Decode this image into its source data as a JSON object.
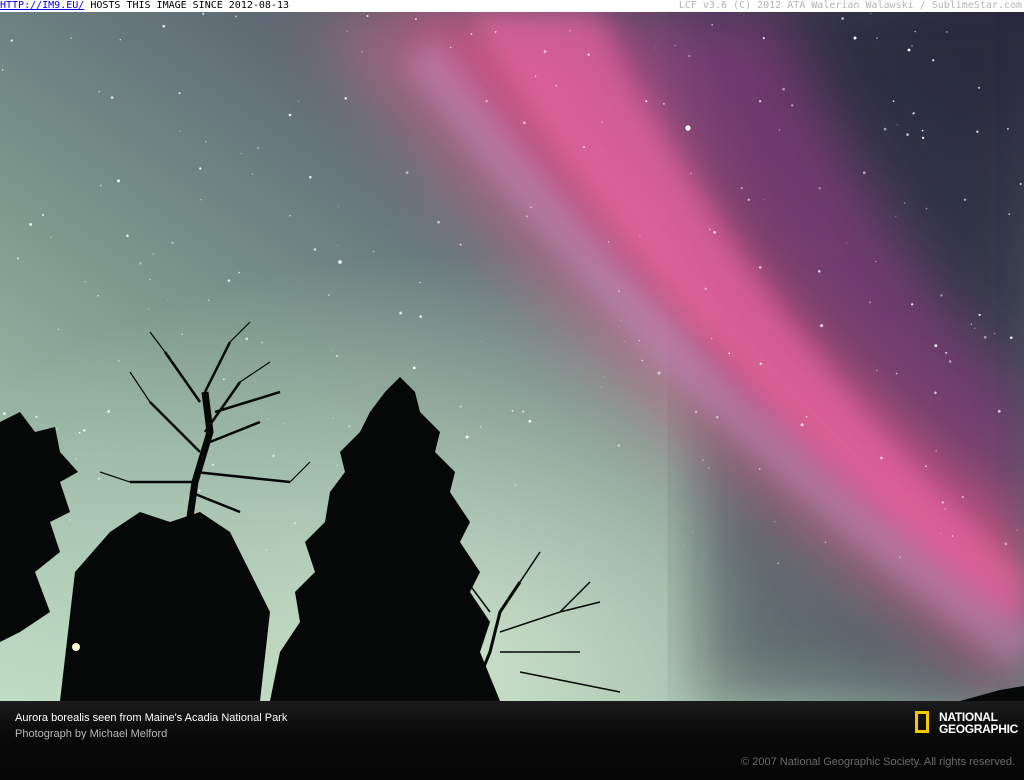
{
  "topbar": {
    "link_text": "HTTP://IM9.EU/",
    "hosting_text": " HOSTS THIS IMAGE SINCE 2012-08-13",
    "credit_text": "LCF v3.6 (C) 2012 ATA Walerian Walawski / SublimeStar.com"
  },
  "photo": {
    "subject": "Aurora borealis over silhouetted trees",
    "colors": {
      "sky_teal": "#5f8378",
      "sky_horizon": "#b6d4bd",
      "aurora_pink": "#e0508a",
      "aurora_magenta": "#b23c85",
      "tree_silhouette": "#050806"
    }
  },
  "caption": {
    "title": "Aurora borealis seen from Maine's Acadia National Park",
    "credit": "Photograph by Michael Melford",
    "copyright": "© 2007 National Geographic Society. All rights reserved.",
    "logo_line1": "NATIONAL",
    "logo_line2": "GEOGRAPHIC",
    "logo_color": "#f5c800"
  }
}
